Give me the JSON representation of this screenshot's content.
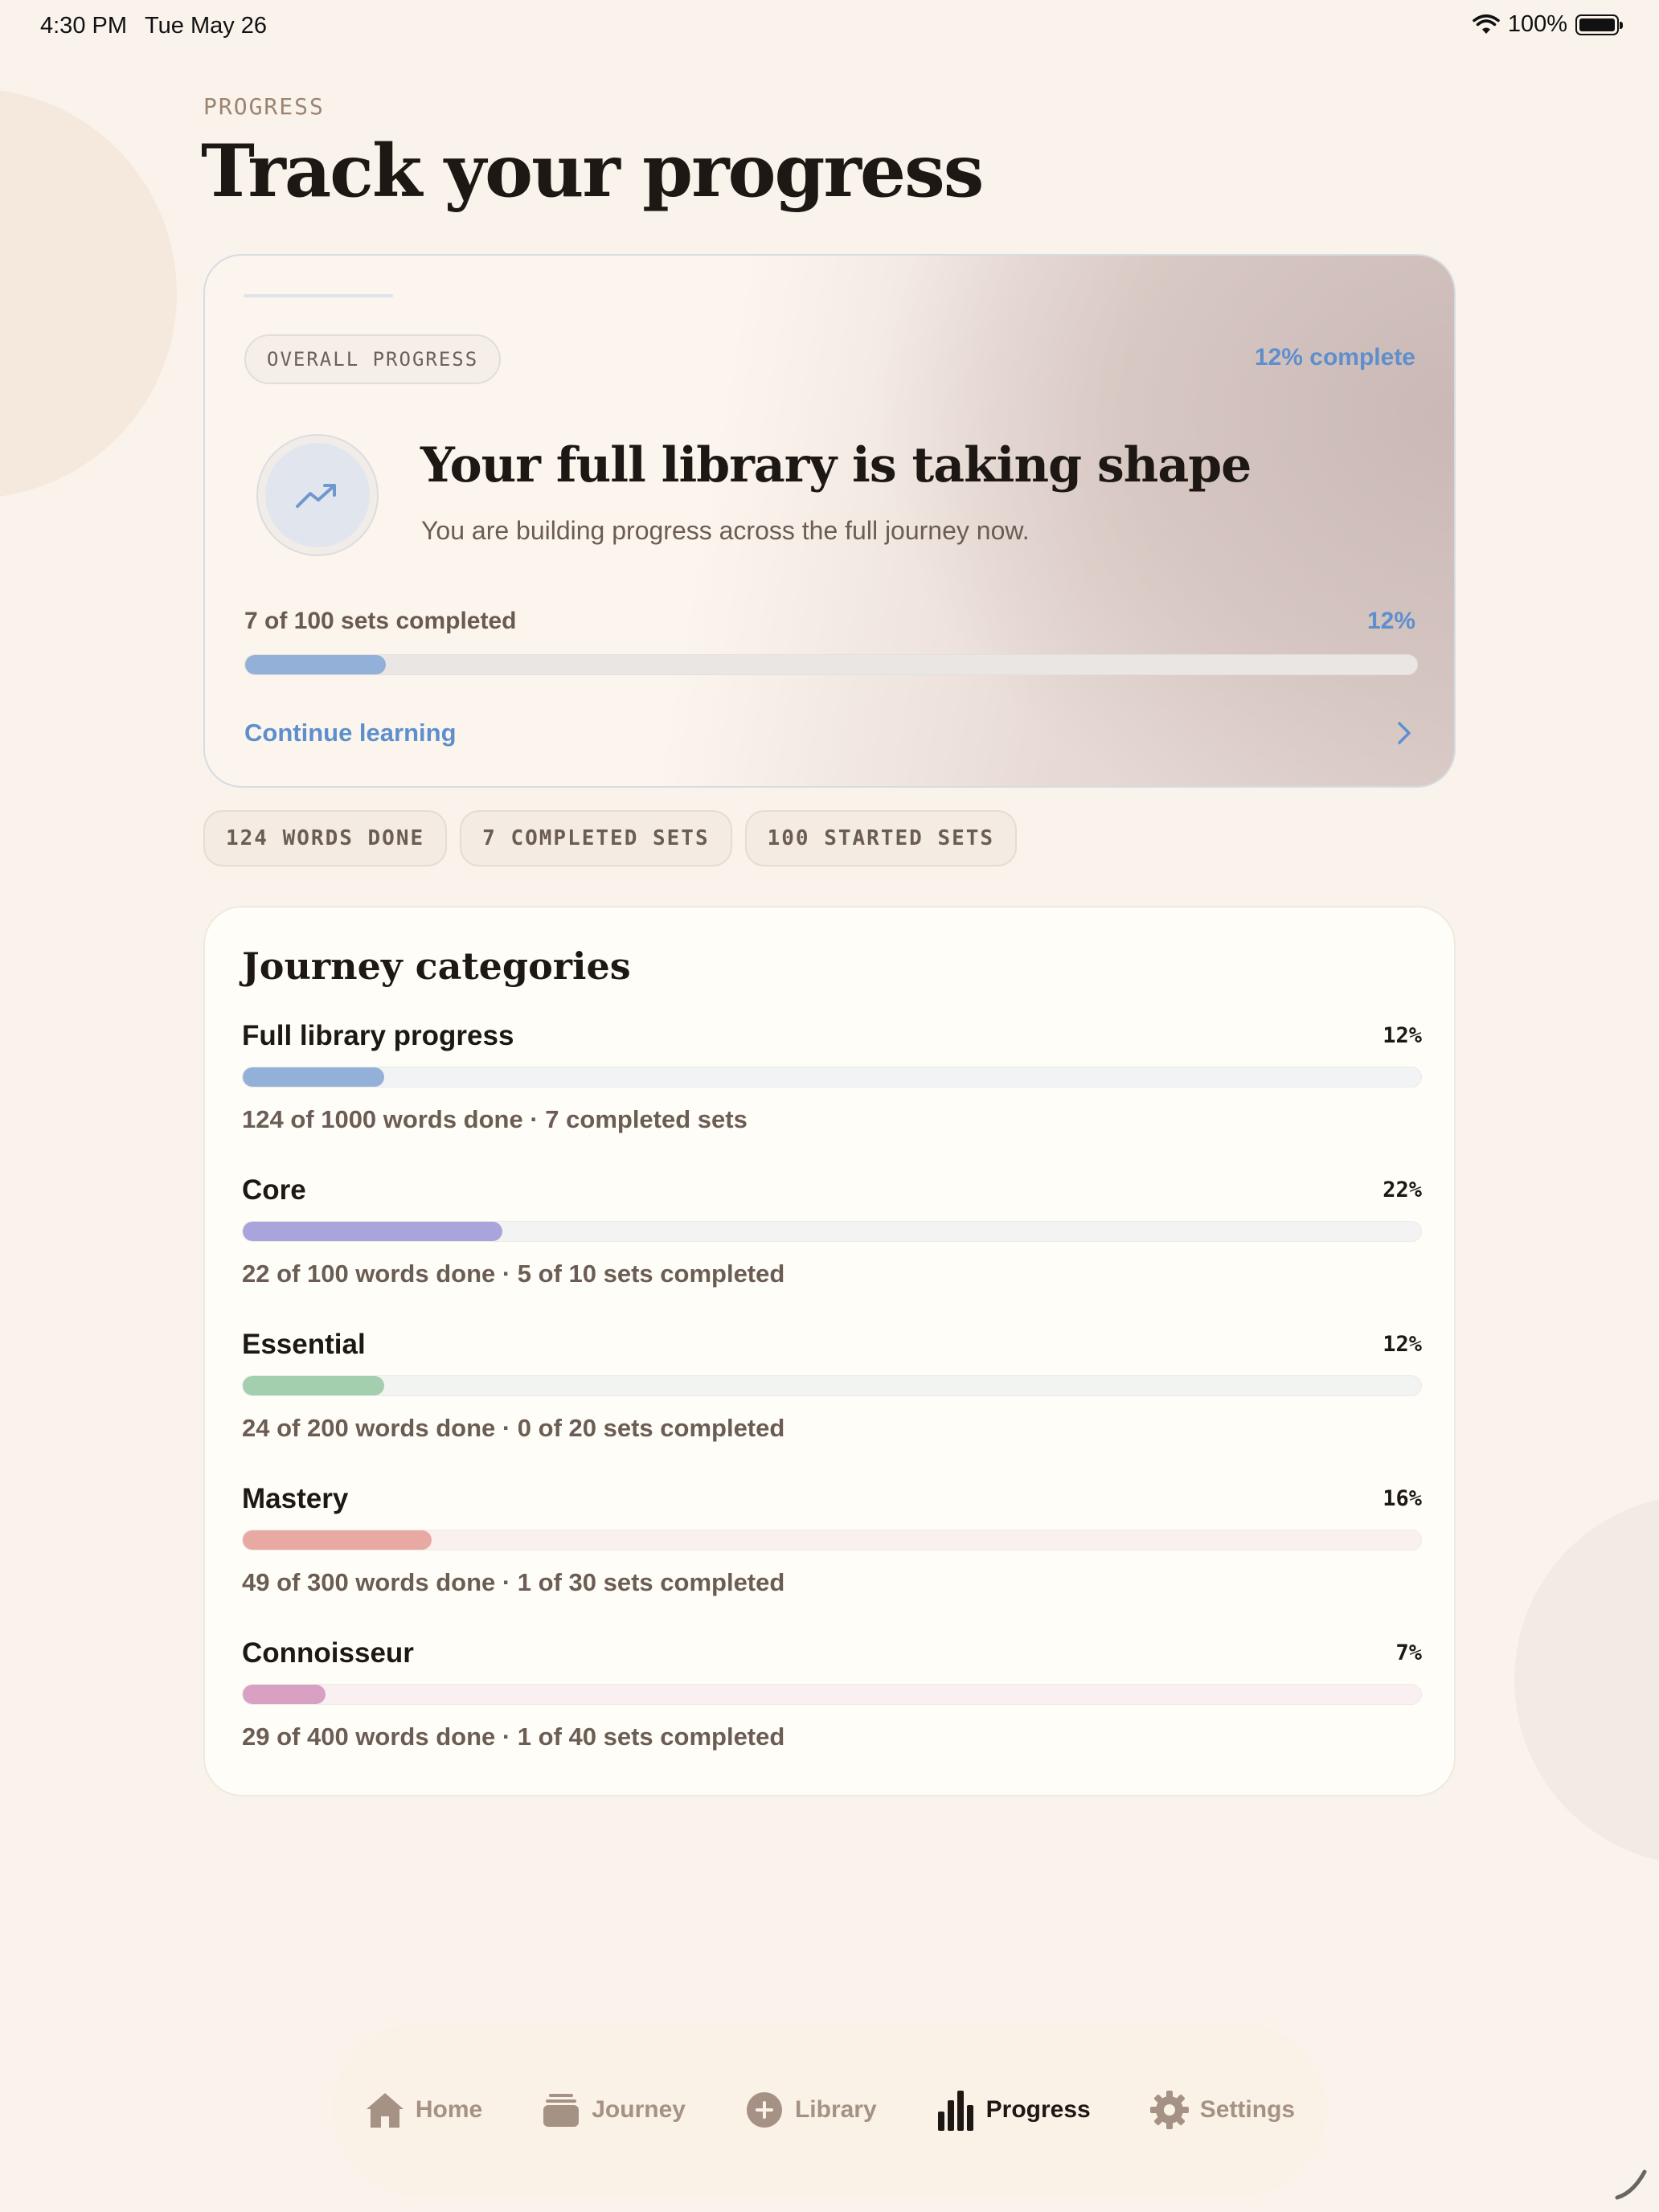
{
  "status_bar": {
    "time": "4:30 PM",
    "date": "Tue May 26",
    "battery": "100%"
  },
  "header": {
    "eyebrow": "PROGRESS",
    "title": "Track your progress"
  },
  "overall": {
    "pill": "OVERALL PROGRESS",
    "percent_complete_label": "12% complete",
    "headline": "Your full library is taking shape",
    "subtitle": "You are building progress across the full journey now.",
    "count_label": "7 of 100 sets completed",
    "percent_label": "12%",
    "progress": 0.12,
    "continue_label": "Continue learning",
    "icon": "trending-up-icon"
  },
  "stats": [
    {
      "label": "124 WORDS DONE"
    },
    {
      "label": "7 COMPLETED SETS"
    },
    {
      "label": "100 STARTED SETS"
    }
  ],
  "categories": {
    "title": "Journey categories",
    "items": [
      {
        "name": "Full library progress",
        "percent_label": "12%",
        "progress": 0.12,
        "detail": "124 of 1000 words done · 7 completed sets",
        "color": "#93b1d8",
        "track": "#f2f3f4"
      },
      {
        "name": "Core",
        "percent_label": "22%",
        "progress": 0.22,
        "detail": "22 of 100 words done · 5 of 10 sets completed",
        "color": "#a9a5dc",
        "track": "#f3f3f4"
      },
      {
        "name": "Essential",
        "percent_label": "12%",
        "progress": 0.12,
        "detail": "24 of 200 words done · 0 of 20 sets completed",
        "color": "#a3cfae",
        "track": "#f2f4f1"
      },
      {
        "name": "Mastery",
        "percent_label": "16%",
        "progress": 0.16,
        "detail": "49 of 300 words done · 1 of 30 sets completed",
        "color": "#e8a9a3",
        "track": "#faf1ee"
      },
      {
        "name": "Connoisseur",
        "percent_label": "7%",
        "progress": 0.07,
        "detail": "29 of 400 words done · 1 of 40 sets completed",
        "color": "#d8a1c4",
        "track": "#faf0f1"
      }
    ]
  },
  "tab_bar": {
    "items": [
      {
        "label": "Home",
        "icon": "home-icon",
        "active": false
      },
      {
        "label": "Journey",
        "icon": "stack-icon",
        "active": false
      },
      {
        "label": "Library",
        "icon": "plus-circle-icon",
        "active": false
      },
      {
        "label": "Progress",
        "icon": "bar-chart-icon",
        "active": true
      },
      {
        "label": "Settings",
        "icon": "gear-icon",
        "active": false
      }
    ]
  },
  "colors": {
    "accent": "#5e8fcd",
    "background": "#faf3ec",
    "text": "#1d1813",
    "muted": "#6b5d53"
  }
}
